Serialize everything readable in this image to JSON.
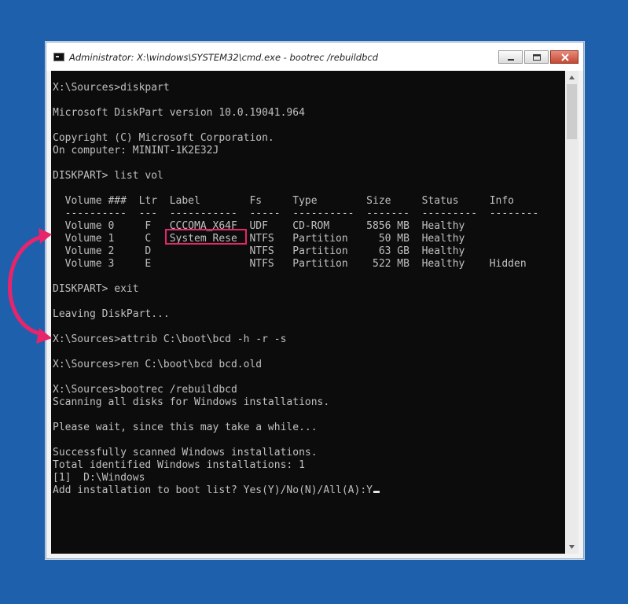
{
  "window": {
    "title": "Administrator: X:\\windows\\SYSTEM32\\cmd.exe - bootrec  /rebuildbcd",
    "icon": "cmd-icon"
  },
  "colors": {
    "desktop": "#1f60ad",
    "console_bg": "#0c0c0c",
    "console_text": "#c0c0c0",
    "annotation": "#e8246b"
  },
  "console": {
    "lines": [
      "X:\\Sources>diskpart",
      "",
      "Microsoft DiskPart version 10.0.19041.964",
      "",
      "Copyright (C) Microsoft Corporation.",
      "On computer: MININT-1K2E32J",
      "",
      "DISKPART> list vol",
      "",
      "  Volume ###  Ltr  Label        Fs     Type        Size     Status     Info",
      "  ----------  ---  -----------  -----  ----------  -------  ---------  --------",
      "  Volume 0     F   CCCOMA_X64F  UDF    CD-ROM      5856 MB  Healthy",
      "  Volume 1     C   System Rese  NTFS   Partition     50 MB  Healthy",
      "  Volume 2     D                NTFS   Partition     63 GB  Healthy",
      "  Volume 3     E                NTFS   Partition    522 MB  Healthy    Hidden",
      "",
      "DISKPART> exit",
      "",
      "Leaving DiskPart...",
      "",
      "X:\\Sources>attrib C:\\boot\\bcd -h -r -s",
      "",
      "X:\\Sources>ren C:\\boot\\bcd bcd.old",
      "",
      "X:\\Sources>bootrec /rebuildbcd",
      "Scanning all disks for Windows installations.",
      "",
      "Please wait, since this may take a while...",
      "",
      "Successfully scanned Windows installations.",
      "Total identified Windows installations: 1",
      "[1]  D:\\Windows",
      "Add installation to boot list? Yes(Y)/No(N)/All(A):Y"
    ]
  }
}
